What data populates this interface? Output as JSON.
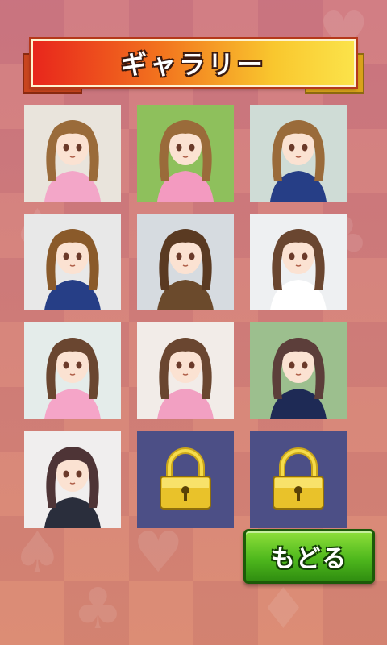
{
  "title": "ギャラリー",
  "back_button_label": "もどる",
  "gallery": [
    {
      "status": "unlocked",
      "hair": "#9a6b3a",
      "top": "#f3a6c8",
      "bg": "#e9e4dc"
    },
    {
      "status": "unlocked",
      "hair": "#9a6b3a",
      "top": "#f39ac0",
      "bg": "#8ec05c"
    },
    {
      "status": "unlocked",
      "hair": "#9a6b3a",
      "top": "#263e86",
      "bg": "#cfdcd6"
    },
    {
      "status": "unlocked",
      "hair": "#8a5a2a",
      "top": "#263e86",
      "bg": "#e8e8e8"
    },
    {
      "status": "unlocked",
      "hair": "#5a3a22",
      "top": "#6b4a2c",
      "bg": "#d6dbe0"
    },
    {
      "status": "unlocked",
      "hair": "#6a4630",
      "top": "#ffffff",
      "bg": "#eef0f2"
    },
    {
      "status": "unlocked",
      "hair": "#6a4630",
      "top": "#f5a5c8",
      "bg": "#e4ecea"
    },
    {
      "status": "unlocked",
      "hair": "#6a4630",
      "top": "#f2a0c2",
      "bg": "#f2ece8"
    },
    {
      "status": "unlocked",
      "hair": "#5c3e3a",
      "top": "#1e2a55",
      "bg": "#9cbf8e"
    },
    {
      "status": "unlocked",
      "hair": "#4e3436",
      "top": "#2a2e3c",
      "bg": "#f0eeee"
    },
    {
      "status": "locked"
    },
    {
      "status": "locked"
    }
  ],
  "icons": {
    "lock": "padlock-icon"
  },
  "colors": {
    "locked_tile": "#4c4f86",
    "back_button": "#4fb81d",
    "banner_left": "#e8261c",
    "banner_right": "#fbe34a"
  }
}
